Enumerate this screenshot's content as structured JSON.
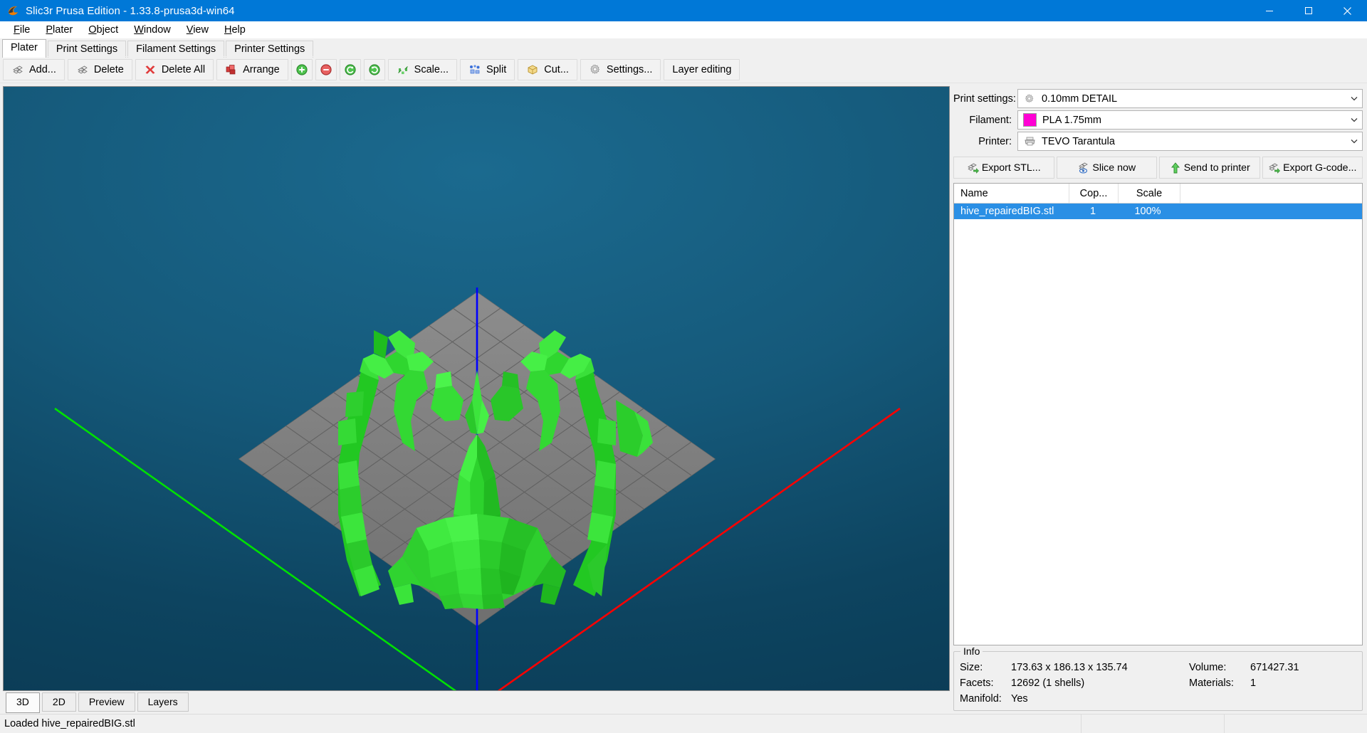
{
  "window": {
    "title": "Slic3r Prusa Edition - 1.33.8-prusa3d-win64",
    "logo_icon": "slic3r-logo-icon",
    "minimize_label": "minimize-icon",
    "maximize_label": "maximize-icon",
    "close_label": "close-icon",
    "titlebar_color": "#0078d7"
  },
  "menu": {
    "items": [
      {
        "label": "File",
        "accel": "F"
      },
      {
        "label": "Plater",
        "accel": "P"
      },
      {
        "label": "Object",
        "accel": "O"
      },
      {
        "label": "Window",
        "accel": "W"
      },
      {
        "label": "View",
        "accel": "V"
      },
      {
        "label": "Help",
        "accel": "H"
      }
    ]
  },
  "tabs": [
    {
      "label": "Plater",
      "active": true
    },
    {
      "label": "Print Settings",
      "active": false
    },
    {
      "label": "Filament Settings",
      "active": false
    },
    {
      "label": "Printer Settings",
      "active": false
    }
  ],
  "toolbar": [
    {
      "label": "Add...",
      "icon": "add-object-icon",
      "icon_only": false
    },
    {
      "label": "Delete",
      "icon": "delete-object-icon",
      "icon_only": false
    },
    {
      "label": "Delete All",
      "icon": "delete-all-icon",
      "icon_only": false
    },
    {
      "label": "Arrange",
      "icon": "arrange-icon",
      "icon_only": false
    },
    {
      "label": "",
      "icon": "increase-copies-icon",
      "icon_only": true
    },
    {
      "label": "",
      "icon": "decrease-copies-icon",
      "icon_only": true
    },
    {
      "label": "",
      "icon": "rotate-ccw-icon",
      "icon_only": true
    },
    {
      "label": "",
      "icon": "rotate-cw-icon",
      "icon_only": true
    },
    {
      "label": "Scale...",
      "icon": "scale-icon",
      "icon_only": false
    },
    {
      "label": "Split",
      "icon": "split-icon",
      "icon_only": false
    },
    {
      "label": "Cut...",
      "icon": "cut-icon",
      "icon_only": false
    },
    {
      "label": "Settings...",
      "icon": "settings-gear-icon",
      "icon_only": false
    },
    {
      "label": "Layer editing",
      "icon": "layer-editing-icon",
      "icon_only": false
    }
  ],
  "presets": [
    {
      "label": "Print settings:",
      "value": "0.10mm DETAIL",
      "icon": "print-settings-gear-icon",
      "swatch": null
    },
    {
      "label": "Filament:",
      "value": "PLA 1.75mm",
      "icon": null,
      "swatch": "#ff00d4"
    },
    {
      "label": "Printer:",
      "value": "TEVO Tarantula",
      "icon": "printer-icon",
      "swatch": null
    }
  ],
  "actions": [
    {
      "label": "Export STL...",
      "icon": "export-stl-icon"
    },
    {
      "label": "Slice now",
      "icon": "slice-now-icon"
    },
    {
      "label": "Send to printer",
      "icon": "send-to-printer-icon"
    },
    {
      "label": "Export G-code...",
      "icon": "export-gcode-icon"
    }
  ],
  "object_table": {
    "columns": [
      "Name",
      "Cop...",
      "Scale"
    ],
    "rows": [
      {
        "name": "hive_repairedBIG.stl",
        "copies": "1",
        "scale": "100%",
        "selected": true
      }
    ],
    "selection_color": "#2a8fe5"
  },
  "info": {
    "legend": "Info",
    "size_key": "Size:",
    "size_value": "173.63 x 186.13 x 135.74",
    "volume_key": "Volume:",
    "volume_value": "671427.31",
    "facets_key": "Facets:",
    "facets_value": "12692 (1 shells)",
    "materials_key": "Materials:",
    "materials_value": "1",
    "manifold_key": "Manifold:",
    "manifold_value": "Yes"
  },
  "view_tabs": [
    {
      "label": "3D",
      "active": true
    },
    {
      "label": "2D",
      "active": false
    },
    {
      "label": "Preview",
      "active": false
    },
    {
      "label": "Layers",
      "active": false
    }
  ],
  "statusbar": {
    "message": "Loaded hive_repairedBIG.stl"
  },
  "viewport": {
    "model_color": "#2ee02e",
    "bed_color": "#808080",
    "axis_x_color": "#ff0000",
    "axis_y_color": "#00e000",
    "axis_z_color": "#0000ff",
    "background_top": "#1b6a8f",
    "background_bottom": "#0a3750"
  }
}
